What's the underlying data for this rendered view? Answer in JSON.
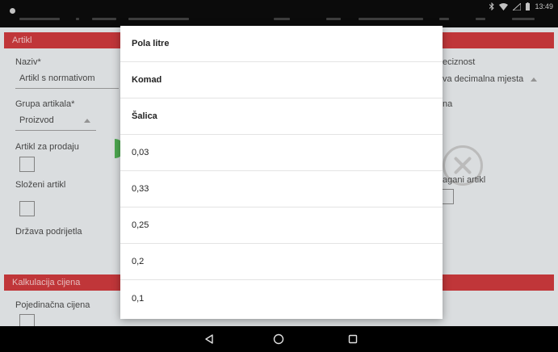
{
  "status_bar": {
    "time": "13:49"
  },
  "sections": {
    "artikl": "Artikl",
    "kalkulacija": "Kalkulacija cijena"
  },
  "form": {
    "naziv_label": "Naziv*",
    "naziv_value": "Artikl s normativom",
    "grupa_label": "Grupa artikala*",
    "grupa_value": "Proizvod",
    "za_prodaju_label": "Artikl za prodaju",
    "slozeni_label": "Složeni artikl",
    "drzava_label": "Država podrijetla",
    "pojedinacna_label": "Pojedinačna cijena",
    "preciznost_label": "eciznost",
    "preciznost_value": "va decimalna mjesta",
    "slika_label": "na",
    "vagani_label": "agani artikl"
  },
  "dialog": {
    "options": [
      "Pola litre",
      "Komad",
      "Šalica",
      "0,03",
      "0,33",
      "0,25",
      "0,2",
      "0,1"
    ]
  }
}
